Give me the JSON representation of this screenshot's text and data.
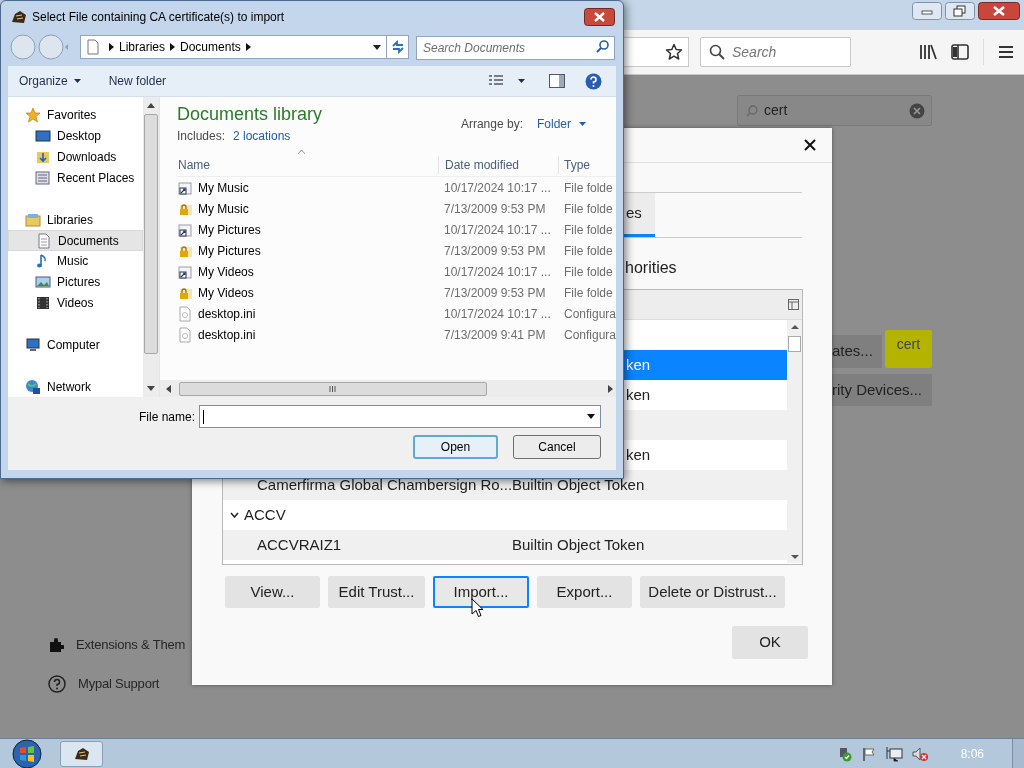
{
  "browser": {
    "search_placeholder": "Search"
  },
  "preferences": {
    "search_value": "cert",
    "buttons": [
      {
        "label": "ates..."
      },
      {
        "label": "rity Devices..."
      }
    ],
    "tooltip": "cert",
    "footer_links": [
      {
        "kind": "extensions",
        "label": "Extensions & Them"
      },
      {
        "kind": "support",
        "label": "Mypal Support"
      }
    ]
  },
  "certificate_manager": {
    "tabs": [
      {
        "label": "es",
        "selected": true
      }
    ],
    "section_title": "horities",
    "rows": [
      {
        "kind": "clipped",
        "tail": "ken",
        "selected": true
      },
      {
        "kind": "clipped",
        "tail": "ken",
        "selected": false
      },
      {
        "kind": "blank",
        "selected": false
      },
      {
        "kind": "clipped",
        "tail": "ken",
        "selected": false
      },
      {
        "kind": "cert",
        "name": "Camerfirma Global Chambersign Ro...",
        "token": "Builtin Object Token",
        "selected": false
      },
      {
        "kind": "group",
        "name": "ACCV",
        "expanded": true,
        "selected": false
      },
      {
        "kind": "cert",
        "name": "ACCVRAIZ1",
        "token": "Builtin Object Token",
        "selected": false
      }
    ],
    "buttons": [
      {
        "label": "View...",
        "focused": false
      },
      {
        "label": "Edit Trust...",
        "focused": false
      },
      {
        "label": "Import...",
        "focused": true
      },
      {
        "label": "Export...",
        "focused": false
      },
      {
        "label": "Delete or Distrust...",
        "focused": false
      }
    ],
    "ok": "OK"
  },
  "file_dialog": {
    "title": "Select File containing CA certificate(s) to import",
    "breadcrumb": [
      "Libraries",
      "Documents"
    ],
    "search_placeholder": "Search Documents",
    "toolbar": [
      "Organize",
      "New folder"
    ],
    "nav": [
      {
        "label": "Favorites",
        "selected": false,
        "children": [
          {
            "label": "Desktop",
            "selected": false
          },
          {
            "label": "Downloads",
            "selected": false
          },
          {
            "label": "Recent Places",
            "selected": false
          }
        ]
      },
      {
        "label": "Libraries",
        "selected": false,
        "children": [
          {
            "label": "Documents",
            "selected": true
          },
          {
            "label": "Music",
            "selected": false
          },
          {
            "label": "Pictures",
            "selected": false
          },
          {
            "label": "Videos",
            "selected": false
          }
        ]
      },
      {
        "label": "Computer",
        "selected": false
      },
      {
        "label": "Network",
        "selected": false
      }
    ],
    "library_title": "Documents library",
    "includes_label": "Includes:",
    "includes_link": "2 locations",
    "arrange_label": "Arrange by:",
    "arrange_value": "Folder",
    "columns": [
      "Name",
      "Date modified",
      "Type"
    ],
    "files": [
      {
        "name": "My Music",
        "date": "10/17/2024 10:17 ...",
        "type": "File folde",
        "kind": "shortcut"
      },
      {
        "name": "My Music",
        "date": "7/13/2009 9:53 PM",
        "type": "File folde",
        "kind": "locked"
      },
      {
        "name": "My Pictures",
        "date": "10/17/2024 10:17 ...",
        "type": "File folde",
        "kind": "shortcut"
      },
      {
        "name": "My Pictures",
        "date": "7/13/2009 9:53 PM",
        "type": "File folde",
        "kind": "locked"
      },
      {
        "name": "My Videos",
        "date": "10/17/2024 10:17 ...",
        "type": "File folde",
        "kind": "shortcut"
      },
      {
        "name": "My Videos",
        "date": "7/13/2009 9:53 PM",
        "type": "File folde",
        "kind": "locked"
      },
      {
        "name": "desktop.ini",
        "date": "10/17/2024 10:17 ...",
        "type": "Configura",
        "kind": "file"
      },
      {
        "name": "desktop.ini",
        "date": "7/13/2009 9:41 PM",
        "type": "Configura",
        "kind": "file"
      }
    ],
    "file_name_label": "File name:",
    "buttons": [
      {
        "label": "Open",
        "default": true
      },
      {
        "label": "Cancel",
        "default": false
      }
    ]
  },
  "taskbar": {
    "clock": "8:06"
  }
}
